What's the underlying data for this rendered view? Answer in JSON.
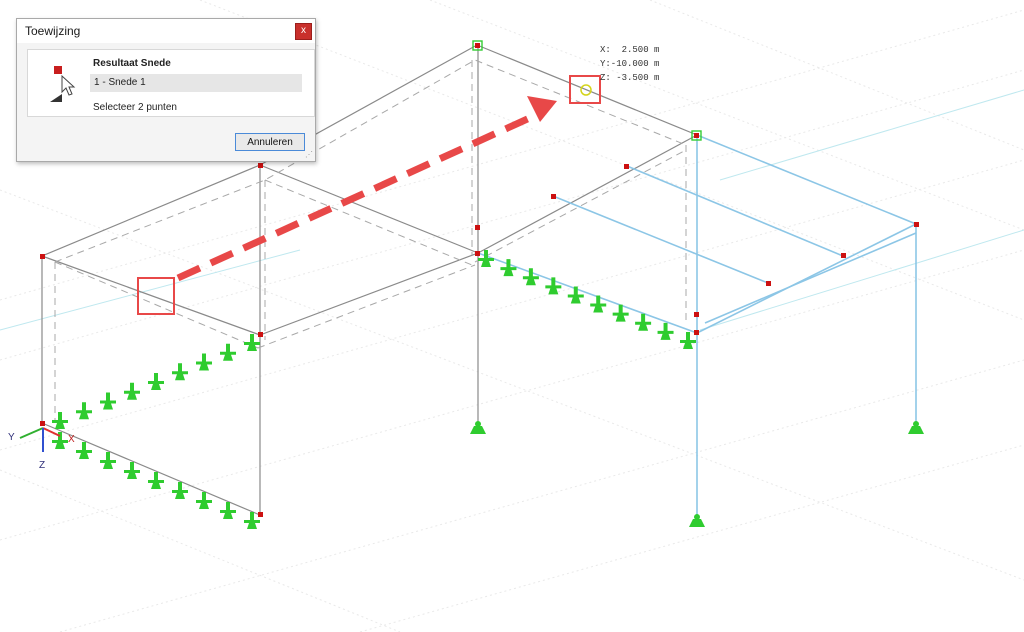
{
  "dialog": {
    "title": "Toewijzing",
    "close_label": "x",
    "field_label": "Resultaat Snede",
    "field_value": "1 - Snede 1",
    "hint": "Selecteer 2 punten",
    "cancel_label": "Annuleren"
  },
  "coordinates": {
    "x": "X:  2.500 m",
    "y": "Y:-10.000 m",
    "z": "Z: -3.500 m"
  },
  "axes": {
    "x": "X",
    "y": "Y",
    "z": "Z"
  },
  "colors": {
    "member": "#8a8a8a",
    "member_highlight": "#8cc6e6",
    "node": "#cc1111",
    "support": "#2fcc2f",
    "arrow": "#e84848",
    "marker_box": "#e84848"
  }
}
